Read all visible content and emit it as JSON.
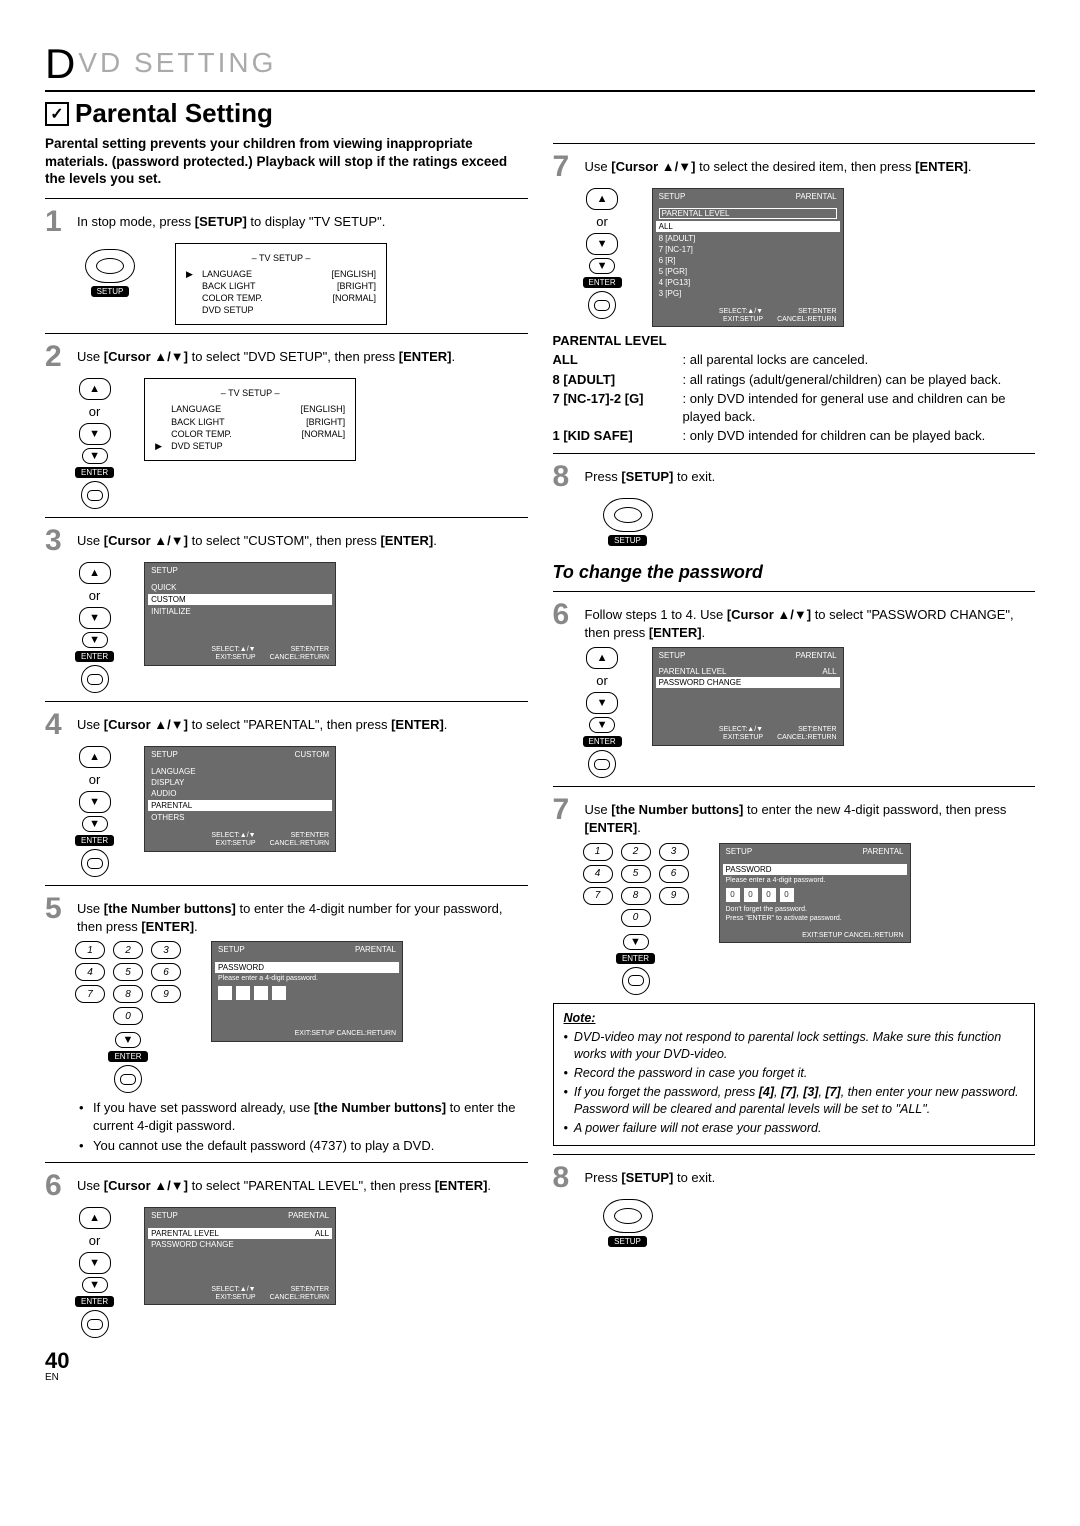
{
  "chapter_prefix": "D",
  "chapter_rest": "VD  SETTING",
  "section_title": "Parental Setting",
  "intro": "Parental setting prevents your children from viewing inappropriate materials. (password protected.) Playback will stop if the ratings exceed the levels you set.",
  "labels": {
    "or": "or",
    "enter": "ENTER",
    "setup": "SETUP"
  },
  "tv_setup": {
    "title": "–  TV SETUP  –",
    "rows": [
      {
        "k": "LANGUAGE",
        "v": "[ENGLISH]"
      },
      {
        "k": "BACK LIGHT",
        "v": "[BRIGHT]"
      },
      {
        "k": "COLOR TEMP.",
        "v": "[NORMAL]"
      },
      {
        "k": "DVD SETUP",
        "v": ""
      }
    ]
  },
  "osd_foot": {
    "left": "SELECT:▲/▼\nEXIT:SETUP",
    "right": "SET:ENTER\nCANCEL:RETURN",
    "exitonly": "EXIT:SETUP   CANCEL:RETURN"
  },
  "osd3": {
    "hdr": "SETUP",
    "items": [
      "QUICK",
      "CUSTOM",
      "INITIALIZE"
    ],
    "sel": 1
  },
  "osd4": {
    "hdr": "SETUP",
    "hdr2": "CUSTOM",
    "items": [
      "LANGUAGE",
      "DISPLAY",
      "AUDIO",
      "PARENTAL",
      "OTHERS"
    ],
    "sel": 3
  },
  "osd5": {
    "hdr": "SETUP",
    "hdr2": "PARENTAL",
    "sub": "PASSWORD",
    "prompt": "Please enter a 4-digit password."
  },
  "osd6": {
    "hdr": "SETUP",
    "hdr2": "PARENTAL",
    "rows": [
      [
        "PARENTAL LEVEL",
        "ALL"
      ],
      [
        "PASSWORD CHANGE",
        ""
      ]
    ],
    "sel": 0
  },
  "osd7L": {
    "hdr": "SETUP",
    "hdr2": "PARENTAL",
    "sub": "PARENTAL LEVEL",
    "items": [
      "ALL",
      "8 [ADULT]",
      "7 [NC-17]",
      "6 [R]",
      "5 [PGR]",
      "4 [PG13]",
      "3 [PG]"
    ],
    "sel": 0
  },
  "osd6R": {
    "hdr": "SETUP",
    "hdr2": "PARENTAL",
    "rows": [
      [
        "PARENTAL LEVEL",
        "ALL"
      ],
      [
        "PASSWORD CHANGE",
        ""
      ]
    ],
    "sel": 1
  },
  "osd7R": {
    "hdr": "SETUP",
    "hdr2": "PARENTAL",
    "sub": "PASSWORD",
    "prompt": "Please enter a 4-digit password.",
    "digits": [
      "0",
      "0",
      "0",
      "0"
    ],
    "l2": "Don't forget the password.",
    "l3": "Press \"ENTER\" to activate password."
  },
  "steps": {
    "s1": "In stop mode, press <b>[SETUP]</b> to display \"TV SETUP\".",
    "s2": "Use <b>[Cursor ▲/▼]</b> to select \"DVD SETUP\", then press <b>[ENTER]</b>.",
    "s3": "Use <b>[Cursor ▲/▼]</b> to select \"CUSTOM\", then press <b>[ENTER]</b>.",
    "s4": "Use <b>[Cursor ▲/▼]</b> to select \"PARENTAL\", then press <b>[ENTER]</b>.",
    "s5": "Use <b>[the Number buttons]</b> to enter the 4-digit number for your password, then press <b>[ENTER]</b>.",
    "s5b1": "If you have set password already, use <b>[the Number buttons]</b> to enter the current 4-digit password.",
    "s5b2": "You cannot use the default password (4737) to play a DVD.",
    "s6": "Use <b>[Cursor ▲/▼]</b> to select \"PARENTAL LEVEL\", then press <b>[ENTER]</b>.",
    "s7": "Use <b>[Cursor ▲/▼]</b> to select the desired item, then press <b>[ENTER]</b>.",
    "s8": "Press <b>[SETUP]</b> to exit.",
    "r6": "Follow steps 1 to 4. Use <b>[Cursor ▲/▼]</b> to select \"PASSWORD CHANGE\", then press <b>[ENTER]</b>.",
    "r7": "Use <b>[the Number buttons]</b> to enter the new 4-digit password, then press <b>[ENTER]</b>.",
    "r8": "Press <b>[SETUP]</b> to exit."
  },
  "parental_level": {
    "title": "PARENTAL LEVEL",
    "rows": [
      {
        "k": "ALL",
        "v": ": all parental locks are canceled."
      },
      {
        "k": "8 [ADULT]",
        "v": ": all ratings (adult/general/children) can be played back."
      },
      {
        "k": "7 [NC-17]-2 [G]",
        "v": ": only DVD intended for general use and children can be played back."
      },
      {
        "k": "1 [KID SAFE]",
        "v": ": only DVD intended for children can be played back."
      }
    ]
  },
  "subsection": "To change the password",
  "note": {
    "title": "Note:",
    "items": [
      "DVD-video may not respond to parental lock settings. Make sure this function works with your DVD-video.",
      "Record the password in case you forget it.",
      "If you forget the password, press <b>[4]</b>, <b>[7]</b>, <b>[3]</b>, <b>[7]</b>, then enter your new password. Password will be cleared and parental levels will be set to \"ALL\".",
      "A power failure will not erase your password."
    ]
  },
  "page_number": "40",
  "lang": "EN"
}
